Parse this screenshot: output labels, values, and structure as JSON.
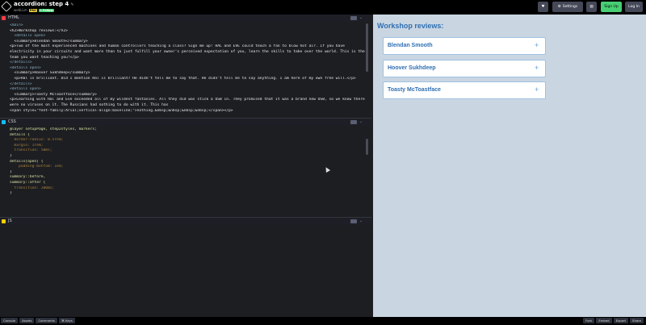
{
  "topbar": {
    "title": "accordion: step 4",
    "pencil_icon": "pencil-icon",
    "author": "webLLm",
    "pro_badge": "PRO",
    "follow_badge": "+ Follow",
    "heart_icon": "heart-icon",
    "settings_label": "Settings",
    "settings_icon": "gear-icon",
    "layout_icon": "layout-icon",
    "signup_label": "Sign Up",
    "login_label": "Log In",
    "colors": {
      "signup": "#47cf73",
      "bar": "#000000"
    }
  },
  "panes": {
    "html": {
      "label": "HTML",
      "icon_color": "#ff3c41"
    },
    "css": {
      "label": "CSS",
      "icon_color": "#0ebeff"
    },
    "js": {
      "label": "JS",
      "icon_color": "#fcd000"
    }
  },
  "html_code": [
    "<main>",
    "<h2>Workshop reviews:</h2>",
    "  <details open>",
    "  <summary>Blendan Smooth</summary>",
    "  <p>Two of the most experienced machines and human controllers teaching a class? Sign me up! HAL and EVE could teach a fan to blow hot air. If you have electricity in your circuits and want more than to just fulfill your owner's perceived expectation of you, learn the skills to take over the world. This is the team you want teaching you!</p>",
    "</details>",
    "<details open>",
    "  <summary>Hoover Sukhdeep</summary>",
    "  <p>Hal is brilliant. Did I mention Hal is brilliant? He didn't tell me to say that. He didn't tell me to say anything. I am here of my own free will.</p>",
    "</details>",
    "<details open>",
    "  <summary>Toasty McToastface</summary>",
    "  <p>Learning with Hal and Eve exceeded all of my wildest fantasies. All they did was stick a USB in. They promised that it was a brand new USB, so we know there were no viruses on it. The Russians had nothing to do with it. This has",
    "<span style=\"font-family:Arial;vertical-align:baseline;\">nothing.&nbsp;&nbsp;&nbsp;&nbsp;</span></p>"
  ],
  "css_code": [
    "@layer setupPage, step2styles, markers;",
    "",
    "details {",
    "  border-radius: 0.5rem;",
    "  margin: 1rem;",
    "  transition: 50ms;",
    "}",
    "details[open] {",
    "    padding-bottom: 1em;",
    "}",
    "",
    "summary::before,",
    "summary::after {",
    "  transition: 200ms;",
    "}"
  ],
  "preview": {
    "heading": "Workshop reviews:",
    "items": [
      {
        "label": "Blendan Smooth",
        "icon": "+"
      },
      {
        "label": "Hoover Sukhdeep",
        "icon": "+"
      },
      {
        "label": "Toasty McToastface",
        "icon": "+"
      }
    ],
    "colors": {
      "background": "#c9d6e2",
      "accent": "#2f6fb1"
    }
  },
  "bottombar": {
    "left": [
      "Console",
      "Assets",
      "Comments",
      "⌘ Keys"
    ],
    "right": [
      "Fork",
      "Embed",
      "Export",
      "Share"
    ]
  }
}
